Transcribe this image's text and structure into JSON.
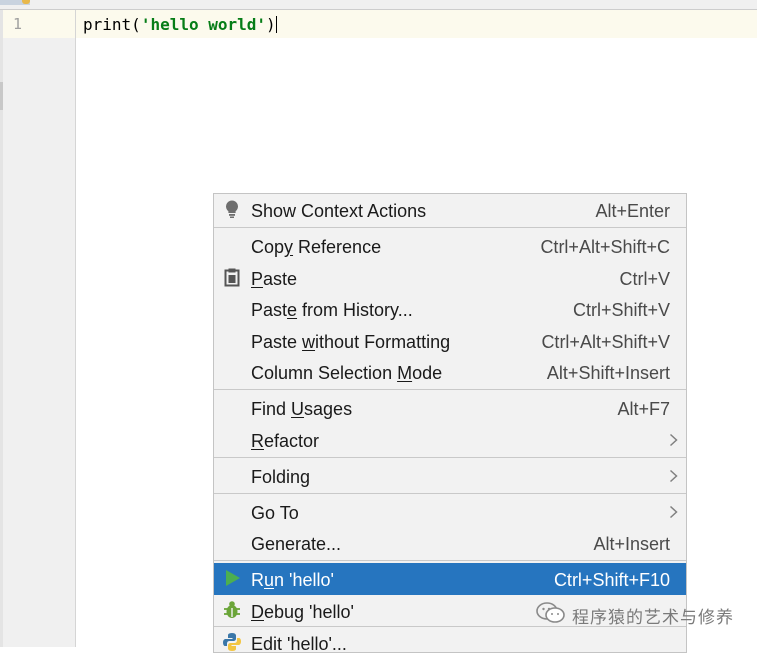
{
  "editor": {
    "line_number": "1",
    "code": {
      "func": "print",
      "open": "(",
      "string": "'hello world'",
      "close": ")"
    }
  },
  "context_menu": {
    "items": [
      {
        "label_parts": [
          "Show Context Actions"
        ],
        "shortcut": "Alt+Enter",
        "icon": "lightbulb-icon"
      },
      {
        "label_parts": [
          "Cop",
          "y",
          " Reference"
        ],
        "shortcut": "Ctrl+Alt+Shift+C"
      },
      {
        "label_parts": [
          "",
          "P",
          "aste"
        ],
        "shortcut": "Ctrl+V",
        "icon": "clipboard-icon"
      },
      {
        "label_parts": [
          "Past",
          "e",
          " from History..."
        ],
        "shortcut": "Ctrl+Shift+V"
      },
      {
        "label_parts": [
          "Paste ",
          "w",
          "ithout Formatting"
        ],
        "shortcut": "Ctrl+Alt+Shift+V"
      },
      {
        "label_parts": [
          "Column Selection ",
          "M",
          "ode"
        ],
        "shortcut": "Alt+Shift+Insert"
      },
      {
        "label_parts": [
          "Find ",
          "U",
          "sages"
        ],
        "shortcut": "Alt+F7"
      },
      {
        "label_parts": [
          "",
          "R",
          "efactor"
        ],
        "submenu": true
      },
      {
        "label_parts": [
          "Folding"
        ],
        "submenu": true
      },
      {
        "label_parts": [
          "Go To"
        ],
        "submenu": true
      },
      {
        "label_parts": [
          "Generate..."
        ],
        "shortcut": "Alt+Insert"
      },
      {
        "label_parts": [
          "R",
          "u",
          "n 'hello'"
        ],
        "shortcut": "Ctrl+Shift+F10",
        "icon": "run-icon",
        "selected": true
      },
      {
        "label_parts": [
          "",
          "D",
          "ebug 'hello'"
        ],
        "icon": "debug-bug-icon"
      },
      {
        "label_parts": [
          "Edit 'hello'..."
        ],
        "icon": "python-icon"
      }
    ]
  },
  "watermark": {
    "text": "程序猿的艺术与修养",
    "icon": "wechat-icon"
  },
  "colors": {
    "selection": "#2675bf",
    "string": "#067d17",
    "run_green": "#4caf50",
    "debug_green": "#6ba539"
  }
}
